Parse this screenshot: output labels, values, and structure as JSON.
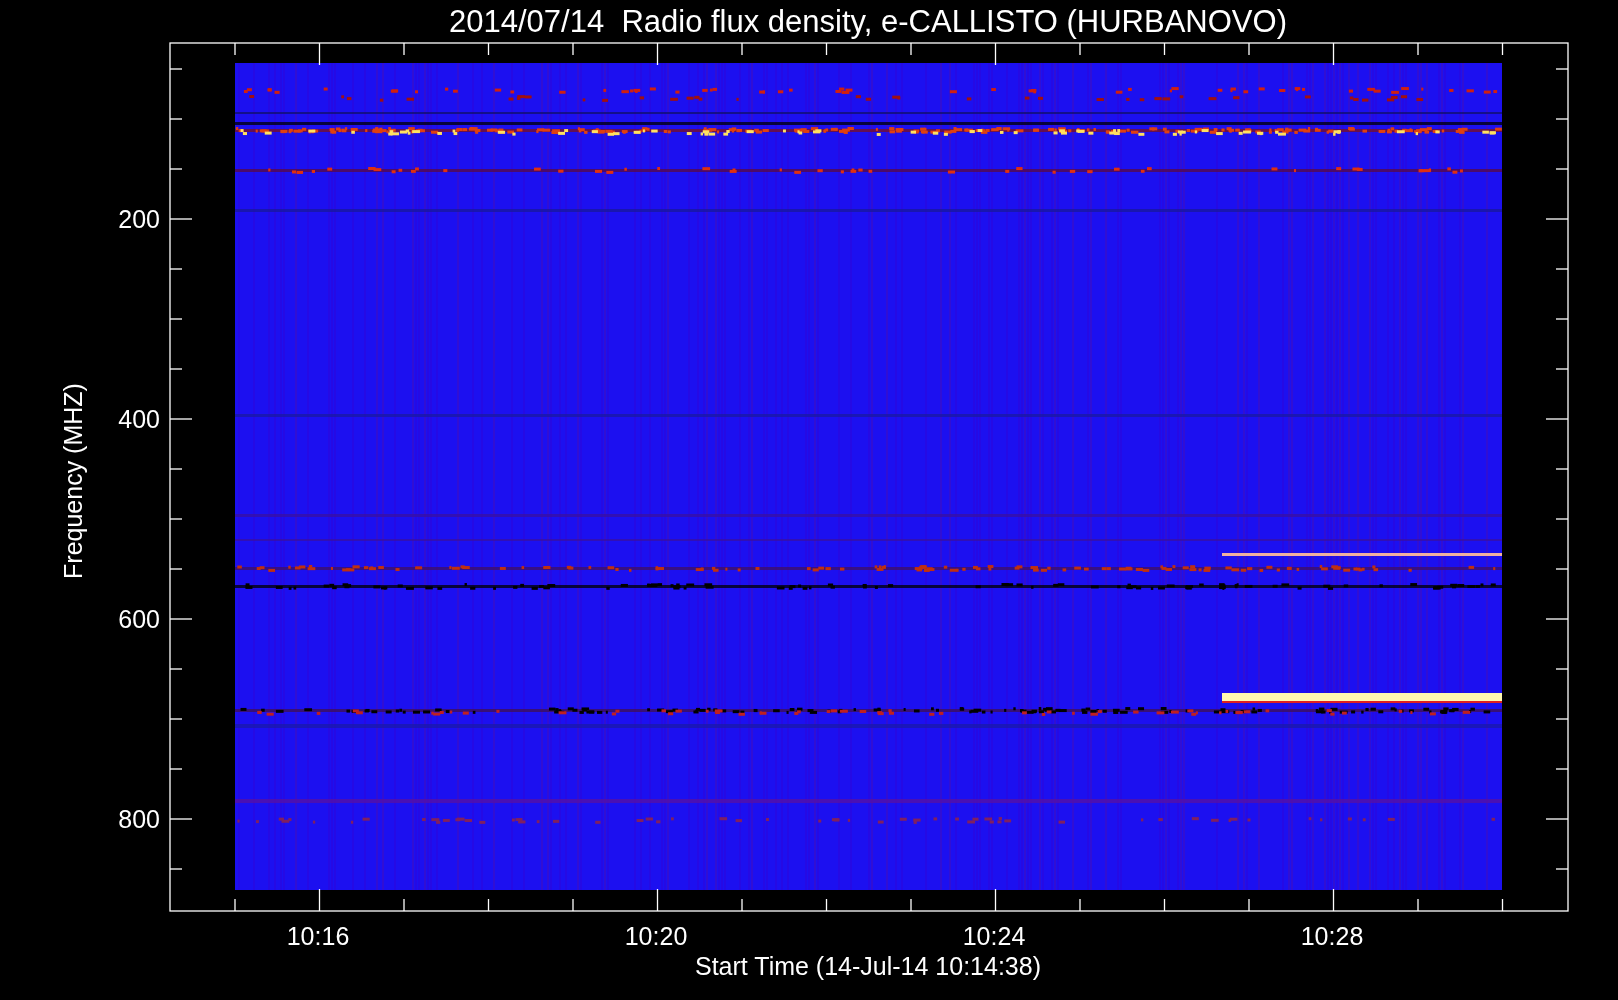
{
  "title": "2014/07/14  Radio flux density, e-CALLISTO (HURBANOVO)",
  "y_axis": {
    "label": "Frequency (MHZ)",
    "ticks": [
      "200",
      "400",
      "600",
      "800"
    ]
  },
  "x_axis": {
    "label": "Start Time (14-Jul-14 10:14:38)",
    "ticks": [
      "10:16",
      "10:20",
      "10:24",
      "10:28"
    ]
  }
}
